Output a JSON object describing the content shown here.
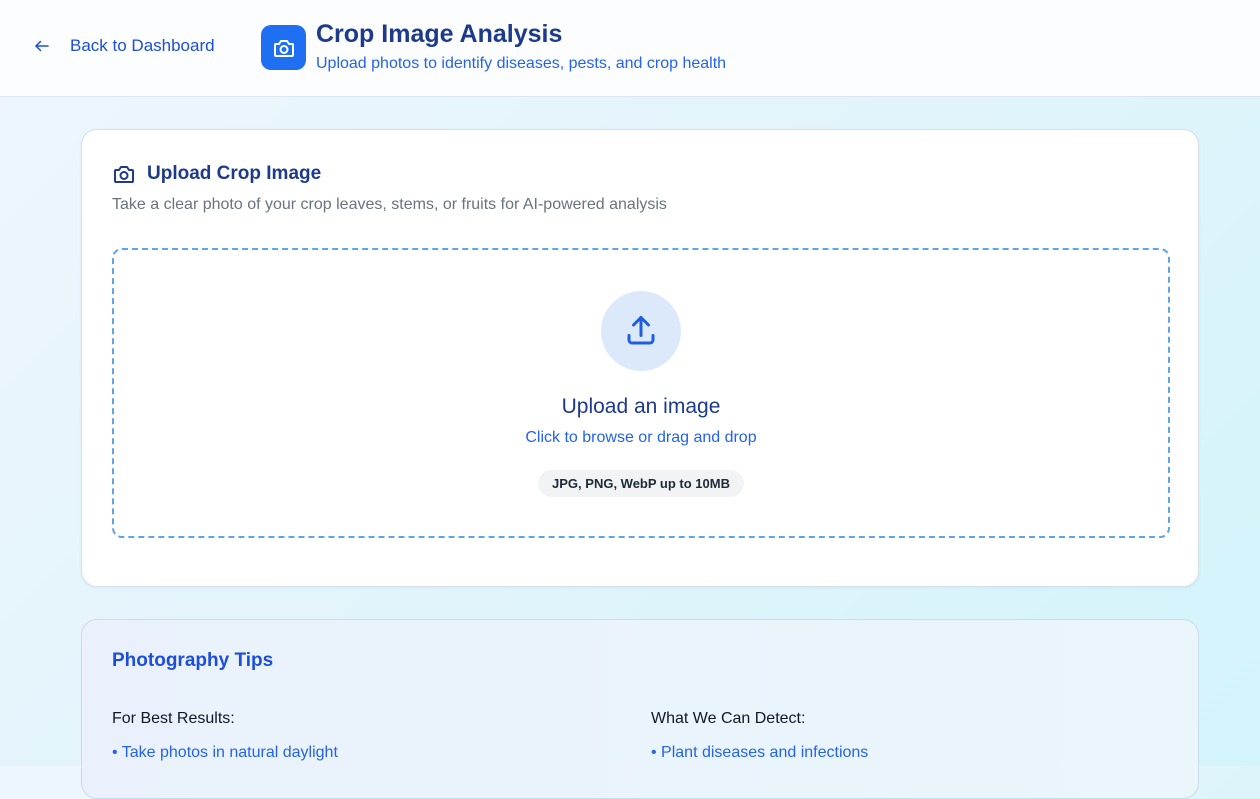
{
  "header": {
    "back_label": "Back to Dashboard",
    "title": "Crop Image Analysis",
    "subtitle": "Upload photos to identify diseases, pests, and crop health"
  },
  "upload_card": {
    "title": "Upload Crop Image",
    "description": "Take a clear photo of your crop leaves, stems, or fruits for AI-powered analysis",
    "dropzone": {
      "title": "Upload an image",
      "subtitle": "Click to browse or drag and drop",
      "formats": "JPG, PNG, WebP up to 10MB"
    }
  },
  "tips": {
    "title": "Photography Tips",
    "best_results": {
      "heading": "For Best Results:",
      "items": [
        "• Take photos in natural daylight"
      ]
    },
    "detect": {
      "heading": "What We Can Detect:",
      "items": [
        "• Plant diseases and infections"
      ]
    }
  },
  "icons": {
    "back": "arrow-left-icon",
    "header": "camera-icon",
    "card": "camera-icon",
    "upload": "upload-icon"
  },
  "colors": {
    "primary": "#1f6ff2",
    "heading": "#1e3a8a",
    "link": "#2563eb",
    "dropzone_border": "#5fa4e3",
    "upload_circle": "#dce9fb"
  }
}
